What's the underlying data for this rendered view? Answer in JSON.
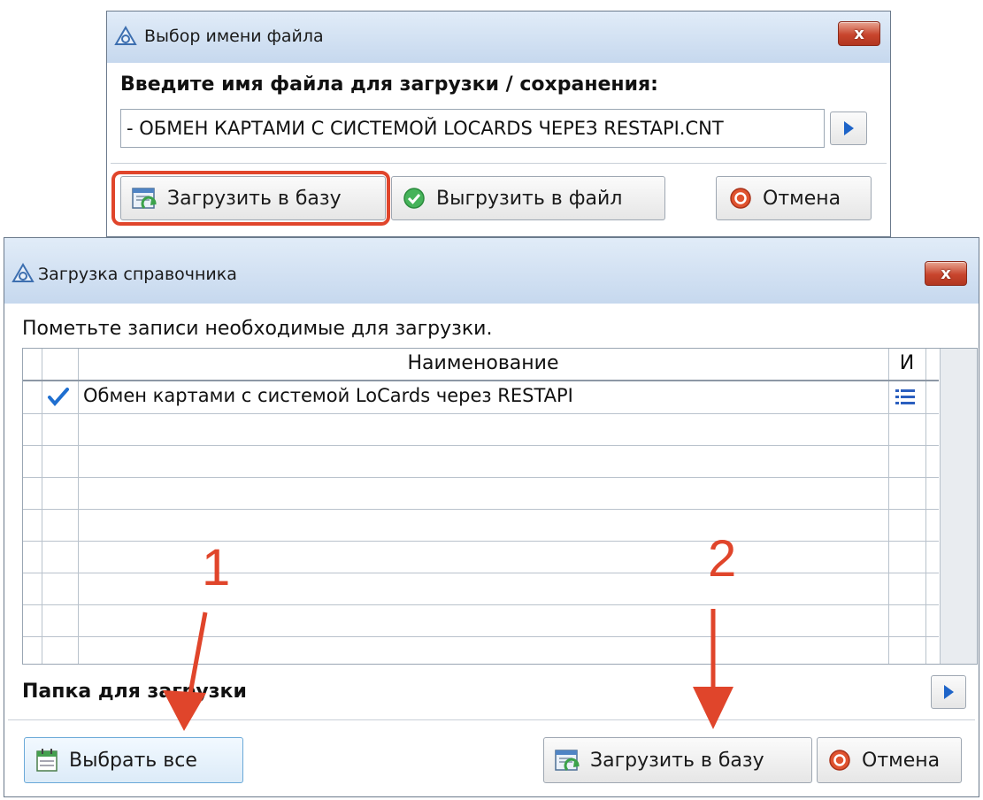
{
  "dialog1": {
    "title": "Выбор имени файла",
    "close_label": "x",
    "prompt": "Введите имя файла для загрузки / сохранения:",
    "filename_value": "- ОБМЕН КАРТАМИ С СИСТЕМОЙ LOCARDS ЧЕРЕЗ RESTAPI.CNT",
    "buttons": {
      "load": "Загрузить в базу",
      "export": "Выгрузить в файл",
      "cancel": "Отмена"
    }
  },
  "dialog2": {
    "title": "Загрузка справочника",
    "close_label": "x",
    "instruction": "Пометьте записи необходимые для загрузки.",
    "table": {
      "columns": [
        "Наименование",
        "И"
      ],
      "rows": [
        {
          "checked": true,
          "name": "Обмен картами с системой LoCards через RESTAPI",
          "icon": "list-icon"
        }
      ]
    },
    "folder_label": "Папка для загрузки",
    "buttons": {
      "select_all": "Выбрать все",
      "load": "Загрузить в базу",
      "cancel": "Отмена"
    }
  },
  "annotations": {
    "marker1": "1",
    "marker2": "2",
    "color": "#e0452b"
  }
}
